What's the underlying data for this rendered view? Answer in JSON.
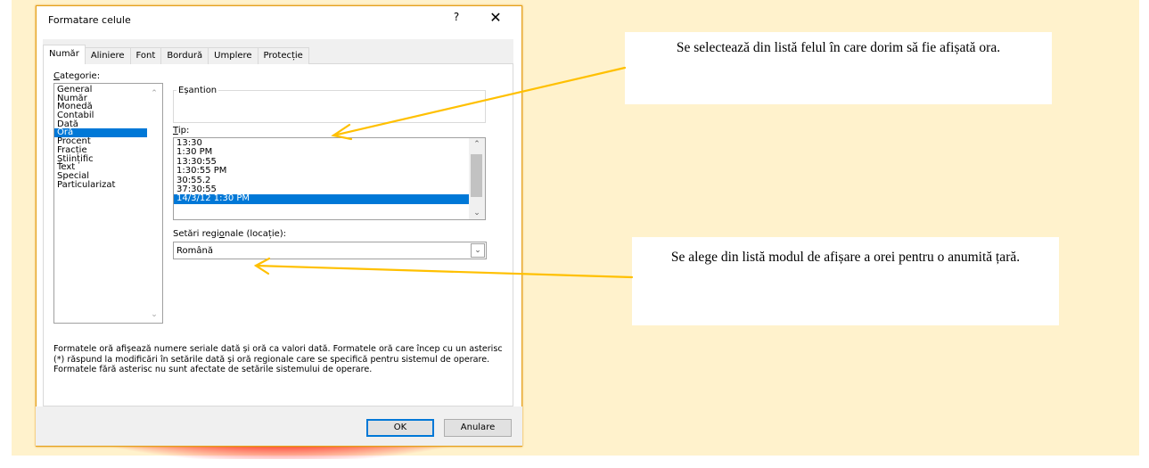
{
  "dialog": {
    "title": "Formatare celule",
    "help_label": "?",
    "close_label": "✕",
    "tabs": [
      "Număr",
      "Aliniere",
      "Font",
      "Bordură",
      "Umplere",
      "Protecție"
    ],
    "category_label_first": "C",
    "category_label_rest": "ategorie:",
    "categories": [
      "General",
      "Număr",
      "Monedă",
      "Contabil",
      "Dată",
      "Oră",
      "Procent",
      "Fracție",
      "Științific",
      "Text",
      "Special",
      "Particularizat"
    ],
    "selected_category": "Oră",
    "sample_label": "Eșantion",
    "type_label_first": "T",
    "type_label_rest": "ip:",
    "types": [
      "13:30",
      "1:30 PM",
      "13:30:55",
      "1:30:55 PM",
      "30:55.2",
      "37:30:55",
      "14/3/12 1:30 PM"
    ],
    "selected_type": "14/3/12 1:30 PM",
    "locale_label_a": "Setări regi",
    "locale_label_u": "o",
    "locale_label_b": "nale (locație):",
    "locale_value": "Română",
    "description": "Formatele oră afișează numere seriale dată și oră ca valori dată. Formatele oră care încep cu un asterisc (*) răspund la modificări în setările dată și oră regionale care se specifică pentru sistemul de operare. Formatele fără asterisc nu sunt afectate de setările sistemului de operare.",
    "ok_label": "OK",
    "cancel_label": "Anulare"
  },
  "callouts": {
    "first": "Se selectează din listă felul în care dorim  să fie afișată ora.",
    "second": "Se alege din listă modul de afișare a orei pentru o anumită țară."
  },
  "colors": {
    "panel_background": "#fff2cc",
    "selection": "#0078d7",
    "arrow": "#ffc000",
    "dialog_shadow": "#ff0000"
  },
  "icons": {
    "scroll_up": "chevron-up-icon",
    "scroll_down": "chevron-down-icon",
    "combo_dropdown": "chevron-down-icon"
  }
}
